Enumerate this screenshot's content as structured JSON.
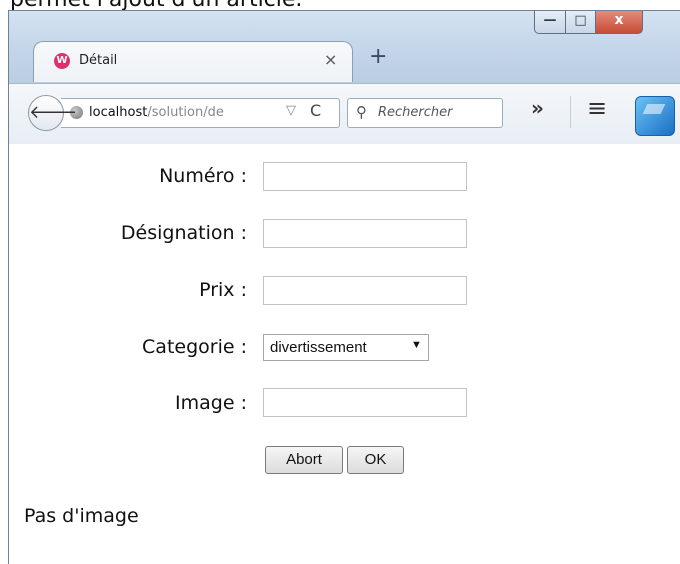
{
  "caption": "permet l'ajout d'un article.",
  "browser": {
    "tab_title": "Détail",
    "tab_close": "×",
    "new_tab": "+",
    "favicon_letter": "W",
    "url_host": "localhost",
    "url_path": "/solution/de",
    "search_placeholder": "Rechercher",
    "overflow_icon": "»",
    "menu_icon": "≡",
    "window_controls": {
      "minimize": "—",
      "maximize": "□",
      "close": "x"
    }
  },
  "form": {
    "numero_label": "Numéro :",
    "designation_label": "Désignation :",
    "prix_label": "Prix :",
    "categorie_label": "Categorie :",
    "categorie_selected": "divertissement",
    "image_label": "Image :",
    "abort_label": "Abort",
    "ok_label": "OK"
  },
  "status_text": "Pas d'image",
  "colors": {
    "close_button": "#c64c36",
    "favicon": "#e0306a",
    "window_frame": "#cfdbe8"
  }
}
